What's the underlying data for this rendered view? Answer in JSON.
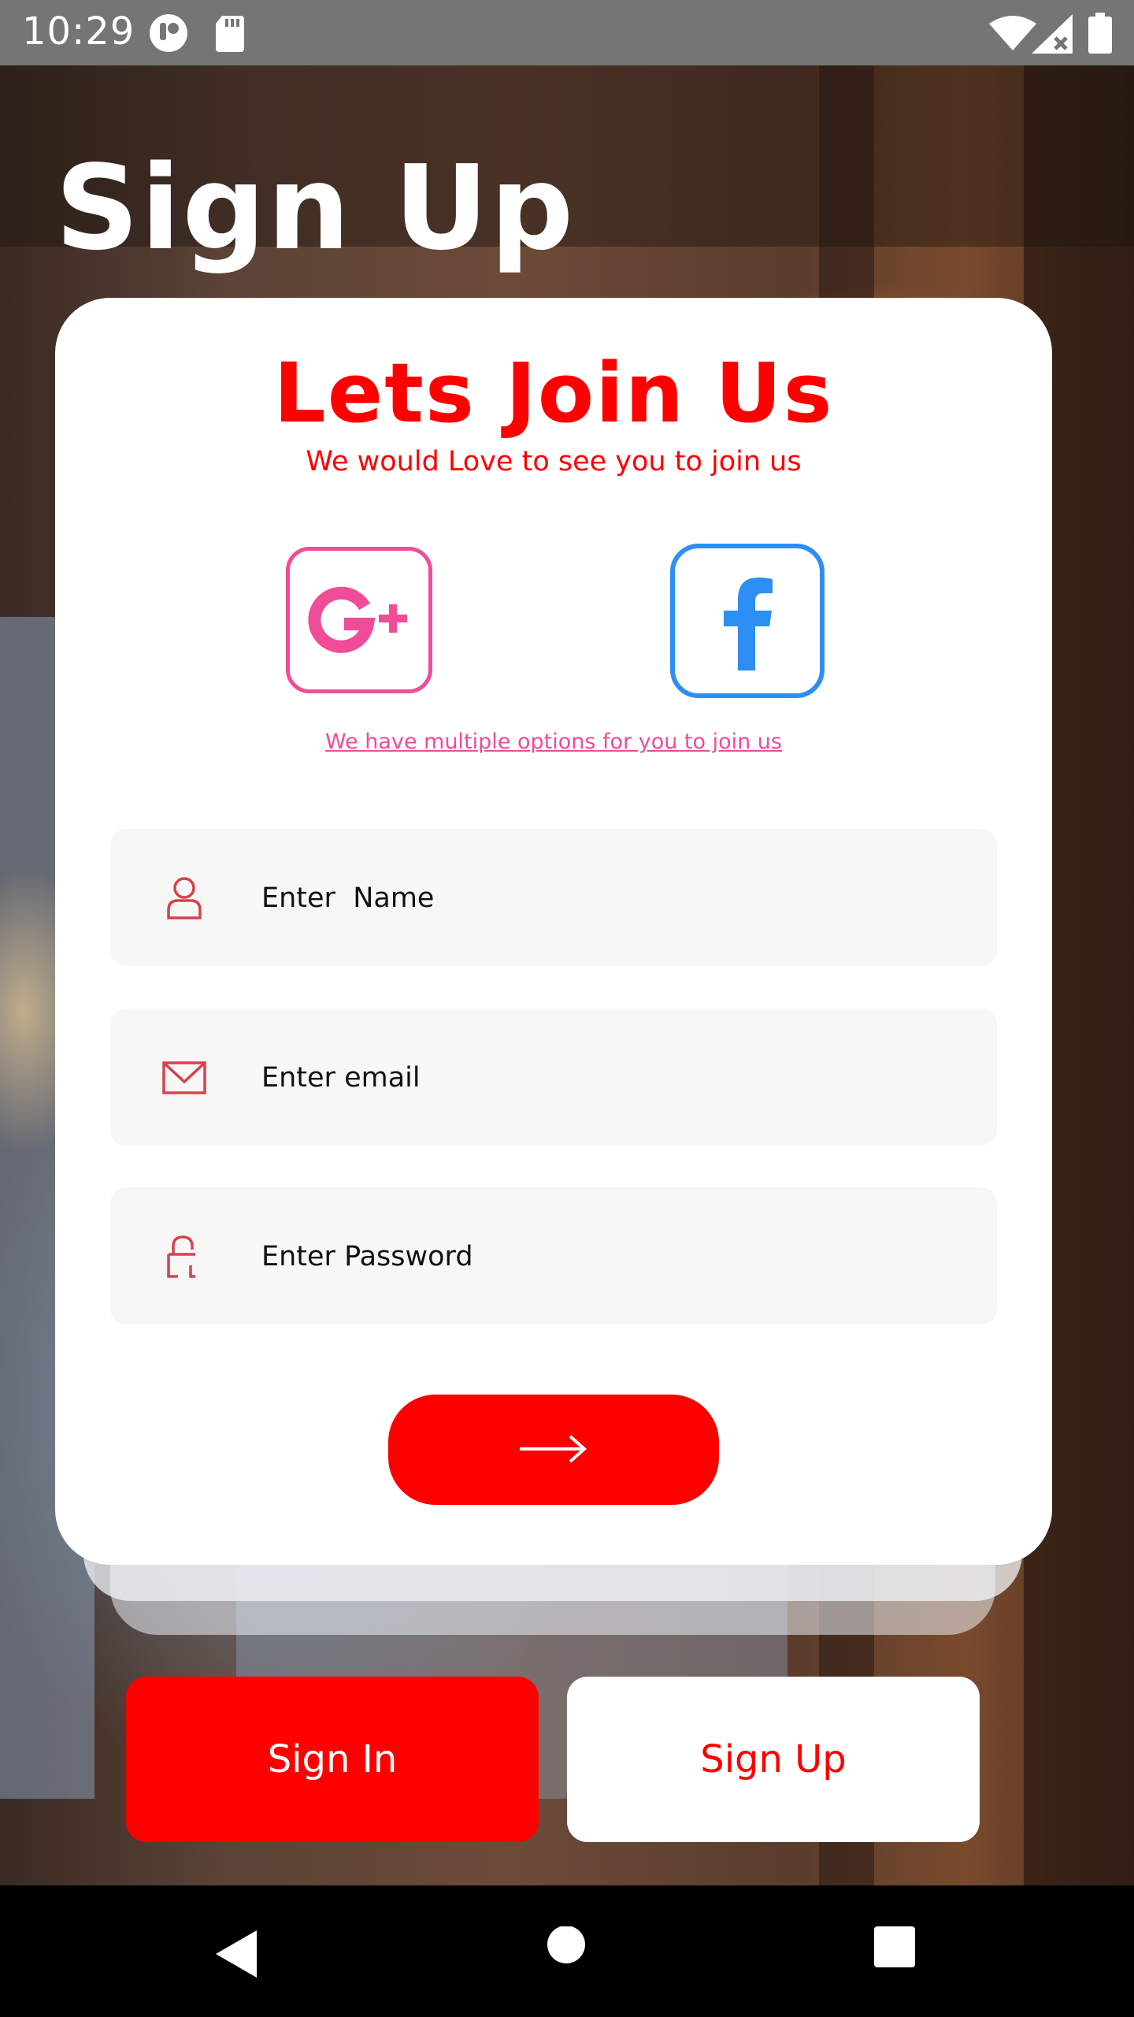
{
  "status_bar": {
    "time": "10:29",
    "icons": [
      "media-app-icon",
      "sd-card-icon",
      "wifi-icon",
      "signal-icon",
      "battery-icon"
    ]
  },
  "page": {
    "title": "Sign Up"
  },
  "card": {
    "title": "Lets Join Us",
    "subtitle": "We would Love to see you to join us",
    "options_link": "We have multiple options for you to join us",
    "social_buttons": [
      {
        "name": "google-plus",
        "icon": "google-plus-icon",
        "color": "#f04c98"
      },
      {
        "name": "facebook",
        "icon": "facebook-icon",
        "color": "#2d8ef4"
      }
    ],
    "fields": {
      "name": {
        "placeholder": "Enter  Name",
        "value": "",
        "icon": "user-icon"
      },
      "email": {
        "placeholder": "Enter email",
        "value": "",
        "icon": "mail-icon"
      },
      "password": {
        "placeholder": "Enter Password",
        "value": "",
        "icon": "lock-icon"
      }
    },
    "submit_icon": "arrow-right-icon"
  },
  "bottom_buttons": {
    "sign_in": "Sign In",
    "sign_up": "Sign Up"
  },
  "nav_bar": {
    "buttons": [
      "back-icon",
      "home-icon",
      "recents-icon"
    ]
  },
  "colors": {
    "accent": "#ff0000",
    "google": "#f04c98",
    "facebook": "#2d8ef4",
    "field_bg": "#f7f7f7",
    "status_bar": "#757575"
  }
}
